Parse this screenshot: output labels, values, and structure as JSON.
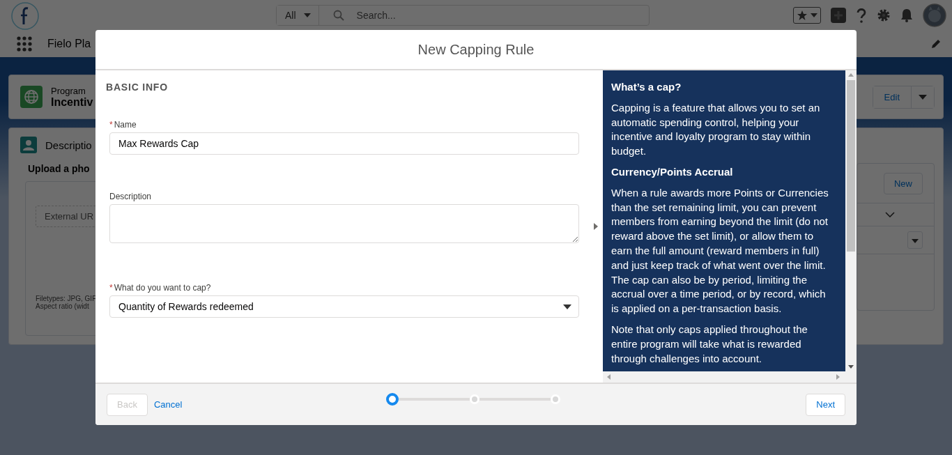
{
  "header": {
    "search_scope": "All",
    "search_placeholder": "Search..."
  },
  "app_name": "Fielo Pla",
  "record": {
    "type": "Program",
    "title": "Incentiv",
    "edit_button": "Edit"
  },
  "description_card": {
    "title": "Descriptio",
    "upload_heading": "Upload a pho",
    "url_field": "External UR",
    "filetypes_note": "Filetypes: JPG, GIF",
    "aspect_note": "Aspect ratio (widt"
  },
  "related_card": {
    "new_button": "New"
  },
  "modal": {
    "title": "New Capping Rule",
    "section_title": "BASIC INFO",
    "required_mark": "*",
    "fields": [
      {
        "kind": "text",
        "label": "Name",
        "required": true,
        "value": "Max Rewards Cap"
      },
      {
        "kind": "textarea",
        "label": "Description",
        "required": false
      },
      {
        "kind": "select",
        "label": "What do you want to cap?",
        "required": true,
        "value": "Quantity of Rewards redeemed"
      }
    ],
    "help": [
      {
        "kind": "heading",
        "text": "What’s a cap?"
      },
      {
        "kind": "paragraph",
        "text": "Capping is a feature that allows you to set an automatic spending control, helping your incentive and loyalty program to stay within budget."
      },
      {
        "kind": "heading",
        "text": "Currency/Points Accrual"
      },
      {
        "kind": "paragraph",
        "text": "When a rule awards more Points or Currencies than the set remaining limit, you can prevent members from earning beyond the limit (do not reward above the set limit), or allow them to earn the full amount (reward members in full) and just keep track of what went over the limit. The cap can also be by period, limiting the accrual over a time period, or by record, which is applied on a per-transaction basis."
      },
      {
        "kind": "paragraph",
        "text": "Note that only caps applied throughout the entire program will take what is rewarded through challenges into account."
      }
    ],
    "footer": {
      "back": {
        "label": "Back",
        "disabled": true
      },
      "cancel": "Cancel",
      "steps": [
        {
          "selected": true
        },
        {
          "selected": false
        },
        {
          "selected": false
        }
      ],
      "next": "Next"
    }
  }
}
